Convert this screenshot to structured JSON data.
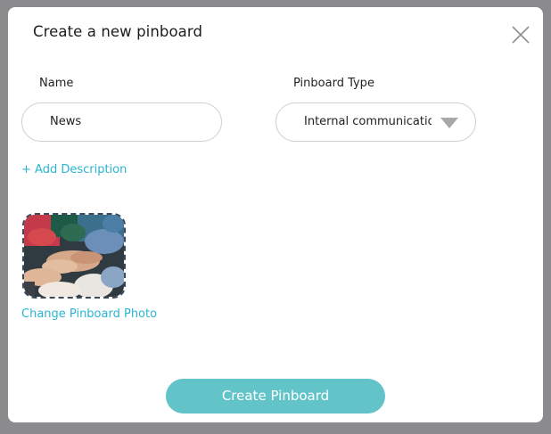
{
  "dialog": {
    "title": "Create a new pinboard",
    "close_icon": "close-icon"
  },
  "form": {
    "name_label": "Name",
    "name_value": "News",
    "type_label": "Pinboard Type",
    "type_value": "Internal communication",
    "add_description_link": "+ Add Description",
    "change_photo_link": "Change Pinboard Photo",
    "submit_label": "Create Pinboard"
  },
  "colors": {
    "accent": "#2bb5d2",
    "button": "#62c3c8",
    "overlay": "#8b8b8d"
  }
}
